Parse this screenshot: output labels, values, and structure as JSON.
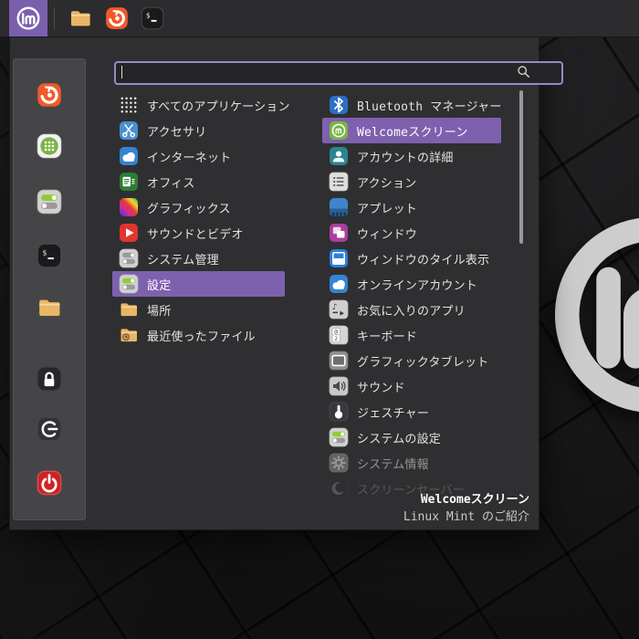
{
  "wallpaper": {
    "emblem_icon": "mint-logo-emblem-icon"
  },
  "panel": {
    "menu_button": {
      "icon": "mint-logo-icon",
      "active_color": "#7a5fae"
    },
    "launchers": [
      {
        "name": "files",
        "icon": "folder-icon"
      },
      {
        "name": "firefox",
        "icon": "firefox-icon"
      },
      {
        "name": "terminal",
        "icon": "terminal-icon"
      }
    ]
  },
  "menu": {
    "accent_color": "#7e61ae",
    "search": {
      "value": "",
      "placeholder": "",
      "icon": "search-icon",
      "border_color": "#9d86cc"
    },
    "favorites": [
      {
        "name": "firefox",
        "icon": "firefox-icon"
      },
      {
        "name": "software-manager",
        "icon": "software-manager-icon"
      },
      {
        "name": "system-settings",
        "icon": "toggles-green-icon"
      },
      {
        "name": "terminal",
        "icon": "terminal-icon"
      },
      {
        "name": "files",
        "icon": "folder-icon"
      }
    ],
    "session_buttons": [
      {
        "name": "lock-screen",
        "icon": "lock-icon"
      },
      {
        "name": "logout",
        "icon": "logout-icon"
      },
      {
        "name": "shutdown",
        "icon": "shutdown-icon"
      }
    ],
    "categories": [
      {
        "label": "すべてのアプリケーション",
        "icon": "apps-grid-icon",
        "color": "#e8e8e8",
        "selected": false
      },
      {
        "label": "アクセサリ",
        "icon": "scissors-icon",
        "color": "#4a8fd2",
        "selected": false
      },
      {
        "label": "インターネット",
        "icon": "cloud-icon",
        "color": "#3583d3",
        "selected": false
      },
      {
        "label": "オフィス",
        "icon": "office-icon",
        "color": "#2d7d33",
        "selected": false
      },
      {
        "label": "グラフィックス",
        "icon": "rainbow-icon",
        "color": "#cc3344",
        "selected": false
      },
      {
        "label": "サウンドとビデオ",
        "icon": "play-icon",
        "color": "#e1352f",
        "selected": false
      },
      {
        "label": "システム管理",
        "icon": "toggles-gray-icon",
        "color": "#d2d2d2",
        "selected": false
      },
      {
        "label": "設定",
        "icon": "toggles-green-icon",
        "color": "#d2d2d2",
        "selected": true
      },
      {
        "label": "場所",
        "icon": "folder-icon",
        "color": "#e9b566",
        "selected": false
      },
      {
        "label": "最近使ったファイル",
        "icon": "folder-clock-icon",
        "color": "#e9b566",
        "selected": false
      }
    ],
    "applications": [
      {
        "label": "Bluetooth マネージャー",
        "icon": "bluetooth-icon",
        "color": "#2d6fc4",
        "selected": false
      },
      {
        "label": "Welcomeスクリーン",
        "icon": "mint-badge-icon",
        "color": "#77b544",
        "selected": true
      },
      {
        "label": "アカウントの詳細",
        "icon": "user-icon",
        "color": "#2a8691",
        "selected": false
      },
      {
        "label": "アクション",
        "icon": "list-icon",
        "color": "#dedede",
        "selected": false
      },
      {
        "label": "アプレット",
        "icon": "applet-icon",
        "color": "#3f86c9",
        "selected": false
      },
      {
        "label": "ウィンドウ",
        "icon": "windows-icon",
        "color": "#a93f9e",
        "selected": false
      },
      {
        "label": "ウィンドウのタイル表示",
        "icon": "window-tiling-icon",
        "color": "#2f7fd6",
        "selected": false
      },
      {
        "label": "オンラインアカウント",
        "icon": "cloud-icon",
        "color": "#3583d3",
        "selected": false
      },
      {
        "label": "お気に入りのアプリ",
        "icon": "favorite-apps-icon",
        "color": "#d0d0d0",
        "selected": false
      },
      {
        "label": "キーボード",
        "icon": "keyboard-icon",
        "color": "#d5d5d5",
        "selected": false
      },
      {
        "label": "グラフィックタブレット",
        "icon": "tablet-icon",
        "color": "#909090",
        "selected": false
      },
      {
        "label": "サウンド",
        "icon": "speaker-icon",
        "color": "#c9c9c9",
        "selected": false
      },
      {
        "label": "ジェスチャー",
        "icon": "gesture-icon",
        "color": "#39393d",
        "selected": false
      },
      {
        "label": "システムの設定",
        "icon": "toggles-green-icon",
        "color": "#d2d2d2",
        "selected": false
      },
      {
        "label": "システム情報",
        "icon": "gear-icon",
        "color": "#8c8c8c",
        "selected": false,
        "opacity": 0.55
      },
      {
        "label": "スクリーンセーバー",
        "icon": "moon-icon",
        "color": "#2c2c30",
        "selected": false,
        "opacity": 0.22
      }
    ],
    "selected_app_info": {
      "title": "Welcomeスクリーン",
      "subtitle": "Linux Mint のご紹介"
    }
  }
}
